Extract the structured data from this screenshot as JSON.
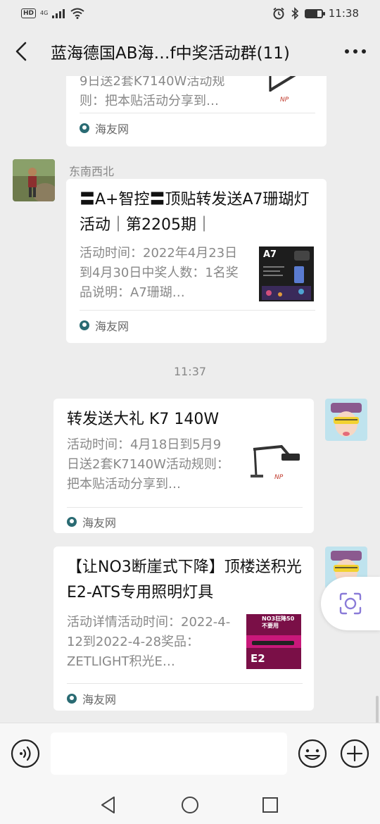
{
  "status_bar": {
    "left_badge": "HD",
    "network": "4G",
    "time": "11:38",
    "battery_level": 0.75,
    "icons": [
      "signal-icon",
      "wifi-icon",
      "alarm-icon",
      "bluetooth-icon",
      "battery-icon"
    ]
  },
  "titlebar": {
    "title": "蓝海德国AB海…f中奖活动群(11)"
  },
  "messages": {
    "m1": {
      "desc": "9日送2套K7140W活动规则：把本贴活动分享到…",
      "source": "海友网"
    },
    "m2": {
      "sender": "东南西北",
      "title": "〓A+智控〓顶贴转发送A7珊瑚灯活动｜第2205期｜",
      "desc": "活动时间：2022年4月23日到4月30日中奖人数：1名奖品说明：A7珊瑚…",
      "source": "海友网",
      "thumb_label": "A7"
    },
    "timestamp": "11:37",
    "m3": {
      "title": "转发送大礼 K7 140W",
      "desc": "活动时间：4月18日到5月9日送2套K7140W活动规则：把本贴活动分享到…",
      "source": "海友网"
    },
    "m4": {
      "title": "【让NO3断崖式下降】顶楼送积光E2-ATS专用照明灯具",
      "desc": "活动详情活动时间：2022-4-12到2022-4-28奖品：ZETLIGHT积光E…",
      "source": "海友网",
      "thumb_top": "NO3狂降50不要用",
      "thumb_mid": "E2"
    }
  },
  "input": {
    "placeholder": ""
  },
  "colors": {
    "background": "#ededed",
    "card": "#ffffff",
    "muted_text": "#888888",
    "source_icon": "#2a6b73",
    "float_icon": "#8a7bd8"
  }
}
